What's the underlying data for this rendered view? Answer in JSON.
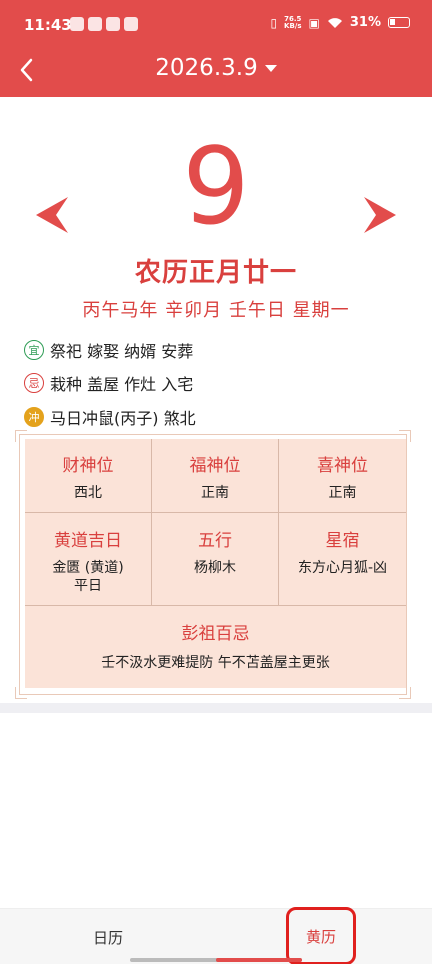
{
  "status_bar": {
    "time": "11:43",
    "net_speed_value": "76.5",
    "net_speed_unit": "KB/s",
    "battery": "31%"
  },
  "header": {
    "date_title": "2026.3.9",
    "back_icon": "chevron-left-icon",
    "dropdown_icon": "caret-down-icon",
    "color": "#e24c4b"
  },
  "day": {
    "number": "9",
    "prev_icon": "arrow-left-icon",
    "next_icon": "arrow-right-icon",
    "lunar": "农历正月廿一",
    "ganzhi": "丙午马年 辛卯月 壬午日 星期一"
  },
  "almanac": {
    "yi_badge": "宜",
    "yi_text": "祭祀 嫁娶 纳婿 安葬",
    "ji_badge": "忌",
    "ji_text": "栽种 盖屋 作灶 入宅",
    "chong_badge": "冲",
    "chong_text": "马日冲鼠(丙子) 煞北"
  },
  "grid": {
    "caishen_title": "财神位",
    "caishen_value": "西北",
    "fushen_title": "福神位",
    "fushen_value": "正南",
    "xishen_title": "喜神位",
    "xishen_value": "正南",
    "huangdao_title": "黄道吉日",
    "huangdao_value_1": "金匮 (黄道)",
    "huangdao_value_2": "平日",
    "wuxing_title": "五行",
    "wuxing_value": "杨柳木",
    "xingxiu_title": "星宿",
    "xingxiu_value": "东方心月狐-凶",
    "pengzu_title": "彭祖百忌",
    "pengzu_value": "壬不汲水更难提防 午不苫盖屋主更张"
  },
  "bottom_nav": {
    "tab_rili": "日历",
    "tab_huangli": "黄历",
    "active_tab": "黄历"
  }
}
